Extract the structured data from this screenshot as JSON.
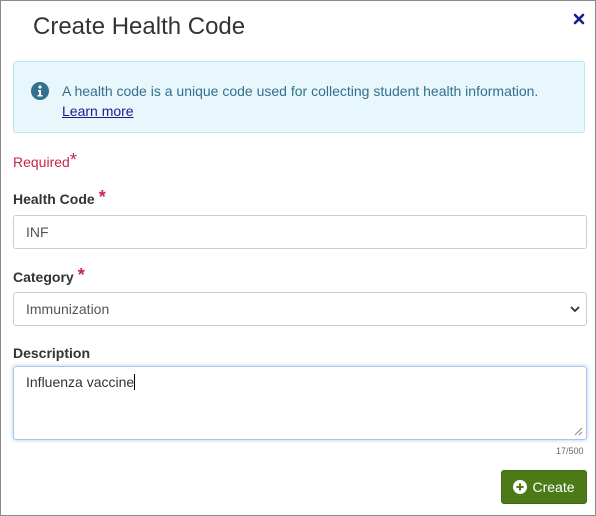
{
  "dialog": {
    "title": "Create Health Code",
    "close_icon": "close-icon"
  },
  "info": {
    "icon": "info-circle-icon",
    "text": "A health code is a unique code used for collecting student health information.",
    "link": "Learn more"
  },
  "form": {
    "required_text": "Required",
    "required_marker": "*",
    "health_code": {
      "label": "Health Code",
      "value": "INF"
    },
    "category": {
      "label": "Category",
      "selected": "Immunization"
    },
    "description": {
      "label": "Description",
      "value": "Influenza vaccine",
      "counter": "17/500"
    }
  },
  "actions": {
    "create_label": "Create",
    "create_icon": "plus-circle-icon"
  },
  "colors": {
    "info_bg": "#e8f7fc",
    "info_text": "#31708f",
    "required": "#c7254e",
    "create_button": "#4b7a17",
    "close_icon": "#1a1a8c"
  }
}
